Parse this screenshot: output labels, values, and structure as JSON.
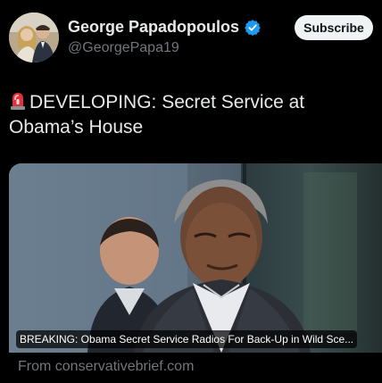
{
  "author": {
    "display_name": "George Papadopoulos",
    "handle": "@GeorgePapa19",
    "verified_icon": "verified-badge-icon",
    "avatar_icon": "profile-photo"
  },
  "actions": {
    "subscribe_label": "Subscribe"
  },
  "tweet": {
    "siren_icon": "police-siren-emoji",
    "text": "DEVELOPING: Secret Service at Obama’s House"
  },
  "link_card": {
    "headline": "BREAKING: Obama Secret Service Radios For Back-Up in Wild Sce...",
    "source": "From conservativebrief.com"
  },
  "colors": {
    "background": "#000000",
    "primary_text": "#e7e9ea",
    "secondary_text": "#71767b",
    "verified_blue": "#1d9bf0",
    "button_bg": "#eff3f4"
  }
}
